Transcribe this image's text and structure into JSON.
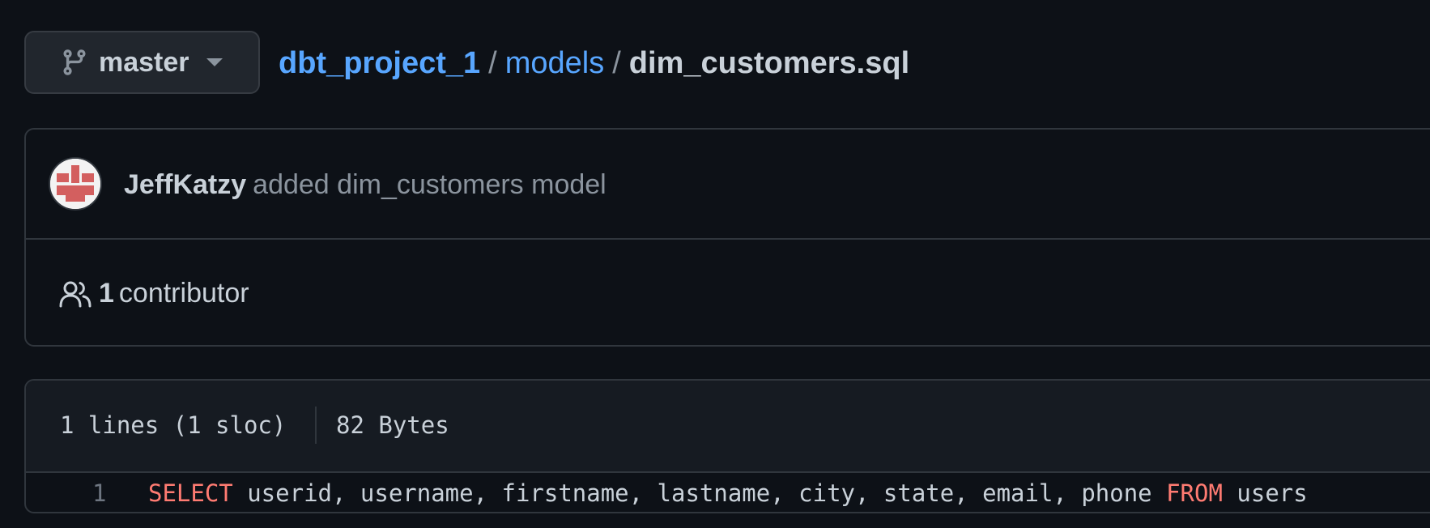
{
  "branch": {
    "name": "master",
    "icon": "git-branch-icon"
  },
  "breadcrumb": {
    "repo": "dbt_project_1",
    "folder": "models",
    "file": "dim_customers.sql",
    "separator": "/"
  },
  "commit": {
    "author": "JeffKatzy",
    "message": "added dim_customers model"
  },
  "contributors": {
    "count": "1",
    "label": "contributor",
    "icon": "people-icon"
  },
  "file": {
    "lines_info": "1 lines (1 sloc)",
    "size": "82 Bytes"
  },
  "code": {
    "lines": [
      {
        "number": "1",
        "keyword1": "SELECT",
        "columns": " userid, username, firstname, lastname, city, state, email, phone ",
        "keyword2": "FROM",
        "table": " users"
      }
    ]
  },
  "colors": {
    "background": "#0d1117",
    "link": "#58a6ff",
    "muted": "#8b949e",
    "keyword": "#ff7b72",
    "border": "#30363d",
    "avatar_red": "#d35f5f"
  }
}
